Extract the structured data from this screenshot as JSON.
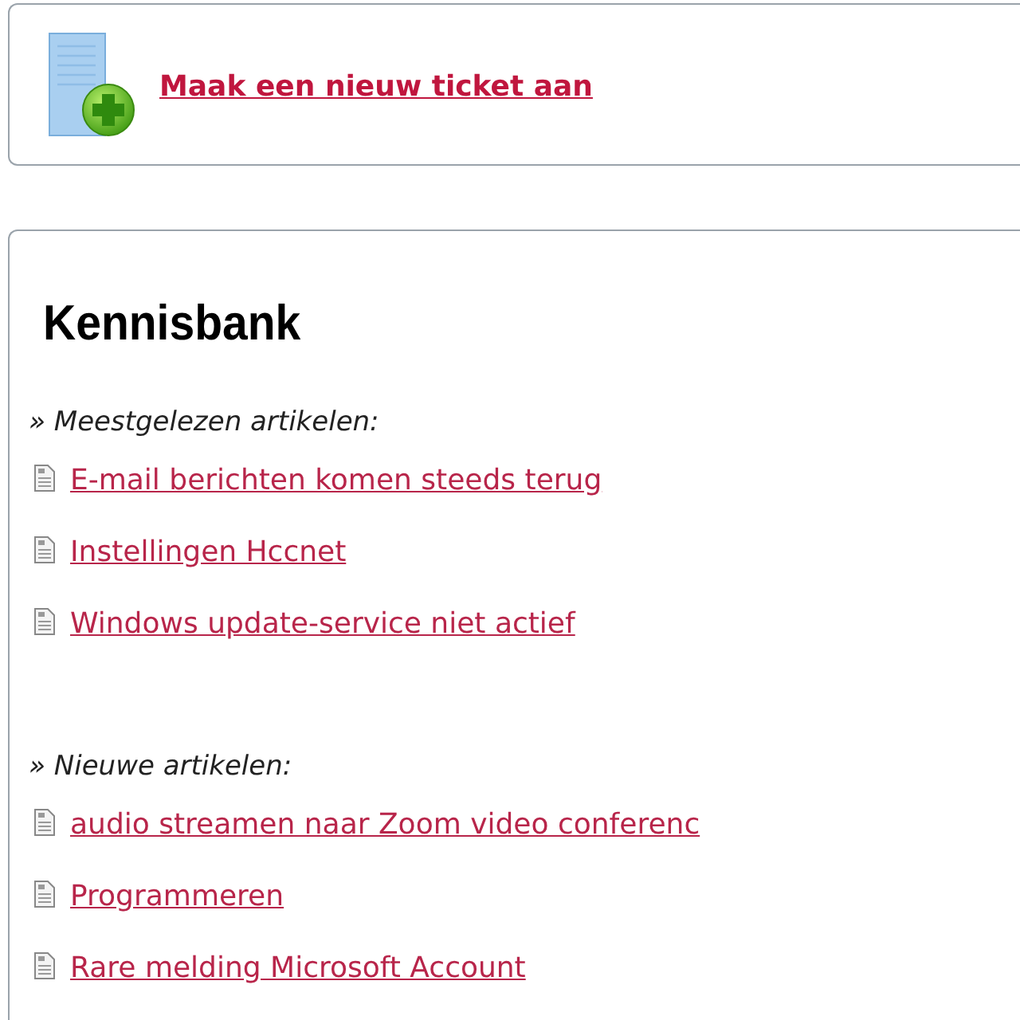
{
  "new_ticket": {
    "label": "Maak een nieuw ticket aan"
  },
  "knowledge_base": {
    "title": "Kennisbank",
    "sections": [
      {
        "heading": "» Meestgelezen artikelen:",
        "articles": [
          "E-mail berichten komen steeds terug",
          "Instellingen Hccnet",
          "Windows update-service niet actief"
        ]
      },
      {
        "heading": "» Nieuwe artikelen:",
        "articles": [
          "audio streamen naar Zoom video conferenc",
          "Programmeren",
          "Rare melding Microsoft Account"
        ]
      }
    ]
  }
}
